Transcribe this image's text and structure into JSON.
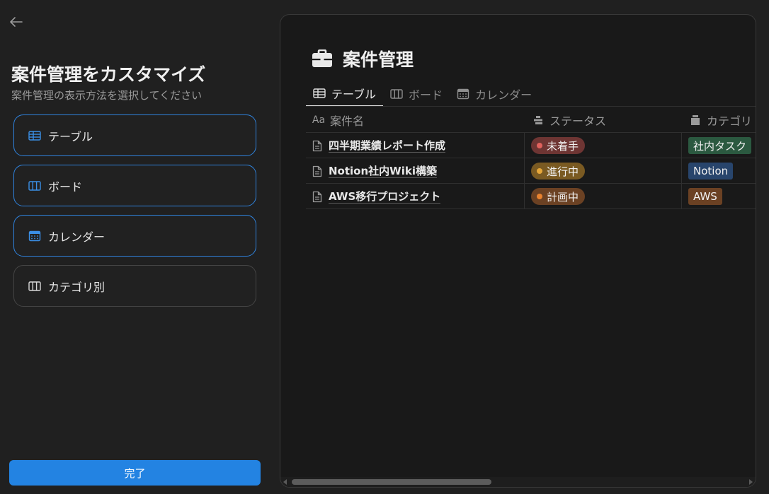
{
  "sidebar": {
    "title": "案件管理をカスタマイズ",
    "subtitle": "案件管理の表示方法を選択してください",
    "options": [
      {
        "label": "テーブル",
        "icon": "table-icon",
        "selected": true
      },
      {
        "label": "ボード",
        "icon": "board-icon",
        "selected": true
      },
      {
        "label": "カレンダー",
        "icon": "calendar-icon",
        "selected": true
      },
      {
        "label": "カテゴリ別",
        "icon": "board-icon",
        "selected": false
      }
    ],
    "done_label": "完了"
  },
  "preview": {
    "title": "案件管理",
    "title_icon": "briefcase-icon",
    "tabs": [
      {
        "label": "テーブル",
        "icon": "table-icon",
        "active": true
      },
      {
        "label": "ボード",
        "icon": "board-icon",
        "active": false
      },
      {
        "label": "カレンダー",
        "icon": "calendar-icon",
        "active": false
      }
    ],
    "columns": [
      {
        "label": "案件名",
        "icon_text": "Aa"
      },
      {
        "label": "ステータス",
        "icon": "status-icon"
      },
      {
        "label": "カテゴリ",
        "icon": "select-icon"
      }
    ],
    "rows": [
      {
        "name": "四半期業績レポート作成",
        "status": {
          "label": "未着手",
          "bg": "#6e3533",
          "dot": "#e0625d"
        },
        "category": {
          "label": "社内タスク",
          "bg": "#2b5940"
        }
      },
      {
        "name": "Notion社内Wiki構築",
        "status": {
          "label": "進行中",
          "bg": "#7a5a22",
          "dot": "#e6a73a"
        },
        "category": {
          "label": "Notion",
          "bg": "#28456c"
        }
      },
      {
        "name": "AWS移行プロジェクト",
        "status": {
          "label": "計画中",
          "bg": "#6b4123",
          "dot": "#e8822f"
        },
        "category": {
          "label": "AWS",
          "bg": "#6b4123"
        }
      }
    ]
  },
  "colors": {
    "accent": "#2383e2",
    "option_border": "#2f83de",
    "background": "#202020",
    "panel": "#191919"
  }
}
